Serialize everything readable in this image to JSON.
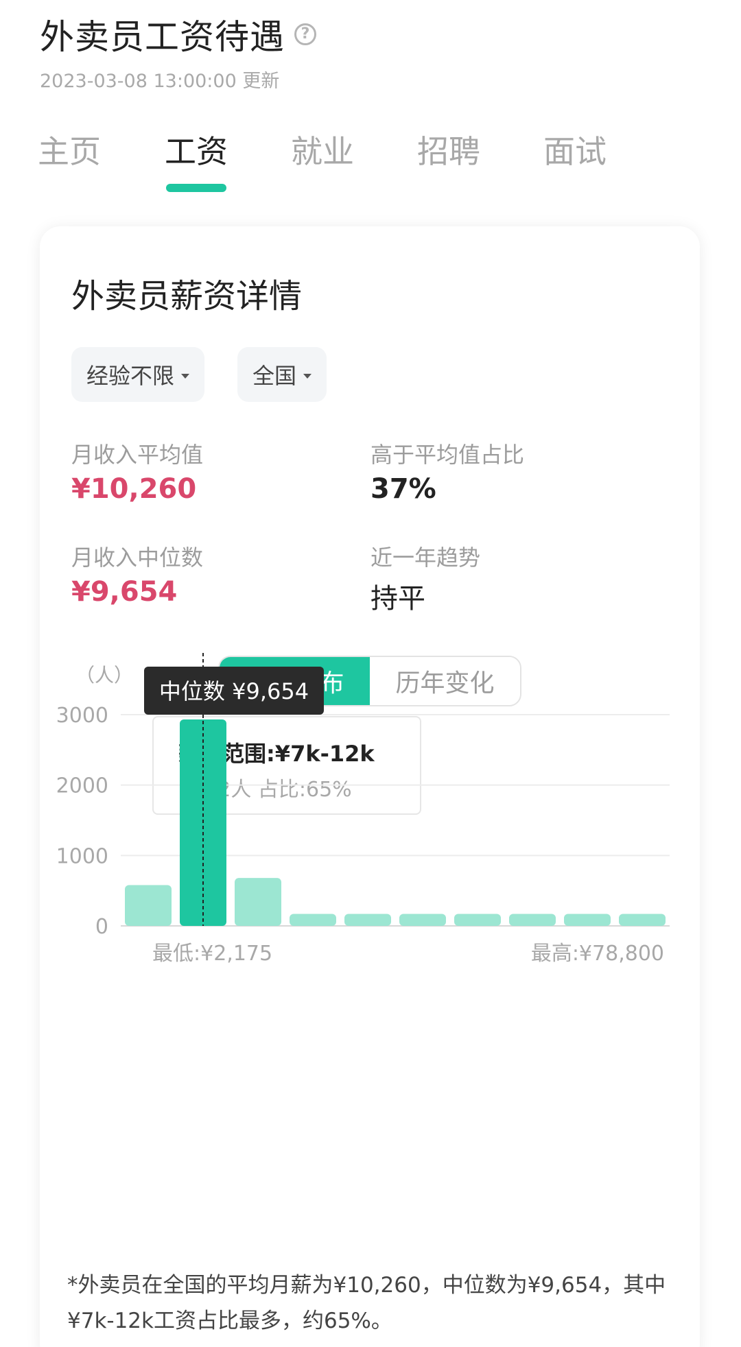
{
  "header": {
    "title": "外卖员工资待遇",
    "help_icon": "question-circle-icon",
    "updated": "2023-03-08 13:00:00 更新"
  },
  "tabs": [
    {
      "label": "主页",
      "active": false
    },
    {
      "label": "工资",
      "active": true
    },
    {
      "label": "就业",
      "active": false
    },
    {
      "label": "招聘",
      "active": false
    },
    {
      "label": "面试",
      "active": false
    }
  ],
  "card": {
    "title": "外卖员薪资详情",
    "filters": {
      "experience": "经验不限",
      "region": "全国"
    },
    "stats": {
      "avg_label": "月收入平均值",
      "avg_value": "¥10,260",
      "above_avg_label": "高于平均值占比",
      "above_avg_value": "37%",
      "median_label": "月收入中位数",
      "median_value": "¥9,654",
      "trend_label": "近一年趋势",
      "trend_value": "持平"
    },
    "segment": {
      "overall": "整体分布",
      "yearly": "历年变化"
    },
    "tooltip": {
      "title": "薪资范围:¥7k-12k",
      "sub": "2932人  占比:65%"
    },
    "footnote": "*外卖员在全国的平均月薪为¥10,260，中位数为¥9,654，其中¥7k-12k工资占比最多，约65%。"
  },
  "colors": {
    "accent": "#1ec6a0",
    "bar_light": "#9ce6d2",
    "pink": "#d9476b"
  },
  "chart_data": {
    "type": "bar",
    "ylabel": "（人）",
    "y_ticks": [
      "3000",
      "2000",
      "1000",
      "0"
    ],
    "ylim": [
      0,
      3000
    ],
    "values": [
      580,
      2932,
      680,
      170,
      170,
      170,
      170,
      170,
      170,
      170
    ],
    "highlight_index": 1,
    "min_label": "最低:¥2,175",
    "max_label": "最高:¥78,800",
    "median_marker_label": "中位数 ¥9,654"
  }
}
